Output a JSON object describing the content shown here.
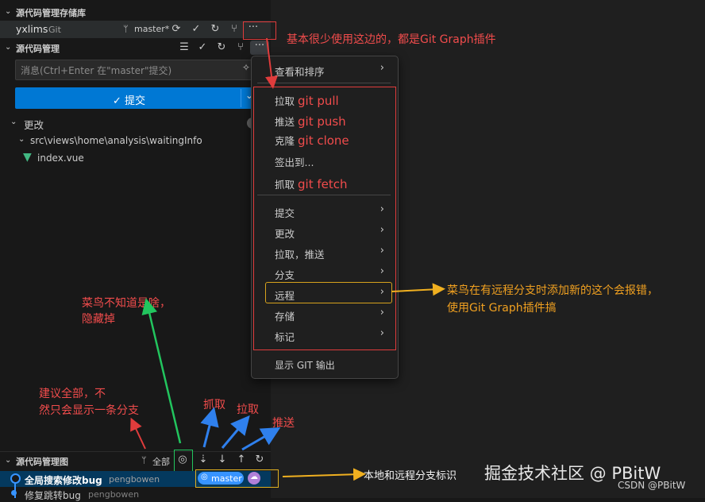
{
  "repos_section": {
    "header": "源代码管理存储库",
    "repo_name": "yxlims",
    "repo_type": "Git",
    "branch": "master*",
    "more": "···"
  },
  "scm_section": {
    "header": "源代码管理",
    "more": "···",
    "message_placeholder": "消息(Ctrl+Enter 在\"master\"提交)",
    "commit_button": "✓ 提交",
    "changes_label": "更改",
    "folder_path": "src\\views\\home\\analysis\\waitingInfo",
    "file_name": "index.vue"
  },
  "menu": {
    "items": [
      {
        "label": "查看和排序",
        "arrow": "›"
      },
      {
        "label": "拉取",
        "git": "git pull"
      },
      {
        "label": "推送",
        "git": "git push"
      },
      {
        "label": "克隆",
        "git": "git clone"
      },
      {
        "label": "签出到..."
      },
      {
        "label": "抓取",
        "git": "git fetch"
      },
      {
        "label": "提交",
        "arrow": "›"
      },
      {
        "label": "更改",
        "arrow": "›"
      },
      {
        "label": "拉取，推送",
        "arrow": "›"
      },
      {
        "label": "分支",
        "arrow": "›"
      },
      {
        "label": "远程",
        "arrow": "›"
      },
      {
        "label": "存储",
        "arrow": "›"
      },
      {
        "label": "标记",
        "arrow": "›"
      },
      {
        "label": "显示 GIT 输出"
      }
    ]
  },
  "graph_section": {
    "header": "源代码管理图",
    "all_label": "全部",
    "commit1_msg": "全局搜索修改bug",
    "commit1_author": "pengbowen",
    "commit2_msg": "修复跳转bug",
    "commit2_author": "pengbowen",
    "branch_badge": "master"
  },
  "annotations": {
    "top_note": "基本很少使用这边的，都是Git Graph插件",
    "remote_note_line1": "菜鸟在有远程分支时添加新的这个会报错，",
    "remote_note_line2": "使用Git Graph插件搞",
    "unknown_line1": "菜鸟不知道是啥，",
    "unknown_line2": "隐藏掉",
    "suggest_line1": "建议全部，不",
    "suggest_line2": "然只会显示一条分支",
    "fetch": "抓取",
    "pull": "拉取",
    "push": "推送",
    "branch_marker_note": "本地和远程分支标识"
  },
  "watermark": {
    "main": "掘金技术社区 @ PBitW",
    "sub": "CSDN @PBitW"
  },
  "colors": {
    "accent_blue": "#0078d4",
    "annotation_red": "#f14c4c",
    "annotation_orange": "#f0a020",
    "vue_green": "#42b883"
  }
}
